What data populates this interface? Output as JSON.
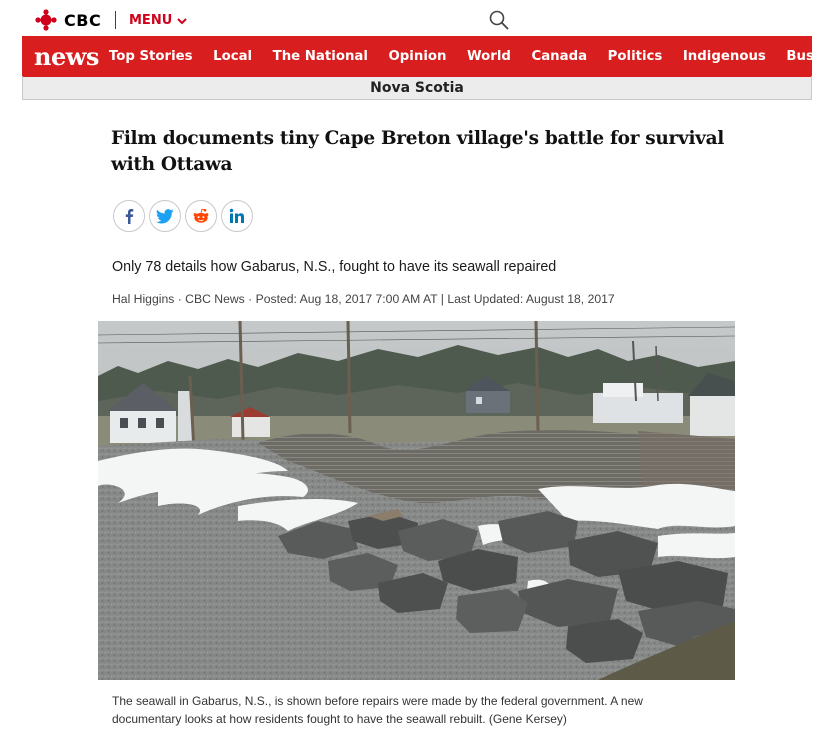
{
  "brand": {
    "logo_text": "CBC",
    "menu_label": "MENU"
  },
  "colors": {
    "cbc_red": "#d81e1e",
    "menu_red": "#d0021b",
    "region_bg": "#ececec"
  },
  "icons": {
    "logo": "cbc-gem-icon",
    "menu": "chevron-down-icon",
    "search": "search-icon"
  },
  "nav": {
    "section_title": "news",
    "links": [
      "Top Stories",
      "Local",
      "The National",
      "Opinion",
      "World",
      "Canada",
      "Politics",
      "Indigenous",
      "Business"
    ]
  },
  "region": {
    "title": "Nova Scotia"
  },
  "article": {
    "headline": "Film documents tiny Cape Breton village's battle for survival with Ottawa",
    "deck": "Only 78 details how Gabarus, N.S., fought to have its seawall repaired",
    "byline": "Hal Higgins · CBC News · Posted: Aug 18, 2017 7:00 AM AT | Last Updated: August 18, 2017",
    "share": [
      {
        "icon": "facebook-icon"
      },
      {
        "icon": "twitter-icon"
      },
      {
        "icon": "reddit-icon"
      },
      {
        "icon": "linkedin-icon"
      }
    ],
    "image_caption": "The seawall in Gabarus, N.S., is shown before repairs were made by the federal government. A new documentary looks at how residents fought to have the seawall rebuilt. (Gene Kersey)"
  }
}
